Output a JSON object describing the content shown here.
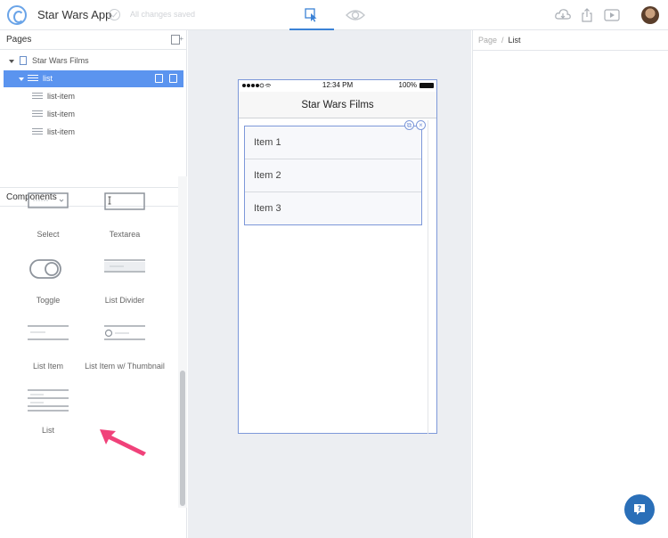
{
  "app": {
    "title": "Star Wars App",
    "save_status": "All changes saved",
    "accent_color": "#3b82d6"
  },
  "topbar": {
    "modes": [
      {
        "name": "design-mode",
        "icon": "cursor-select-icon",
        "active": true
      },
      {
        "name": "preview-mode",
        "icon": "eye-icon",
        "active": false
      }
    ],
    "actions": [
      "cloud-download-icon",
      "share-icon",
      "play-icon"
    ]
  },
  "pages_panel": {
    "title": "Pages",
    "tree": [
      {
        "label": "Star Wars Films",
        "icon": "page-icon",
        "level": 0,
        "expanded": true
      },
      {
        "label": "list",
        "icon": "list-icon",
        "level": 1,
        "expanded": true,
        "selected": true
      },
      {
        "label": "list-item",
        "icon": "list-item-icon",
        "level": 2
      },
      {
        "label": "list-item",
        "icon": "list-item-icon",
        "level": 2
      },
      {
        "label": "list-item",
        "icon": "list-item-icon",
        "level": 2
      }
    ]
  },
  "components_panel": {
    "title": "Components",
    "items": [
      {
        "label": "Select",
        "icon": "select-icon"
      },
      {
        "label": "Textarea",
        "icon": "textarea-icon"
      },
      {
        "label": "Toggle",
        "icon": "toggle-icon"
      },
      {
        "label": "List Divider",
        "icon": "list-divider-icon"
      },
      {
        "label": "List Item",
        "icon": "list-item-icon"
      },
      {
        "label": "List Item w/ Thumbnail",
        "icon": "list-item-thumbnail-icon"
      },
      {
        "label": "List",
        "icon": "list-icon"
      }
    ]
  },
  "device": {
    "status": {
      "time": "12:34 PM",
      "battery": "100%"
    },
    "nav_title": "Star Wars Films",
    "list_items": [
      "Item 1",
      "Item 2",
      "Item 3"
    ]
  },
  "inspector": {
    "breadcrumb": [
      "Page",
      "List"
    ]
  }
}
